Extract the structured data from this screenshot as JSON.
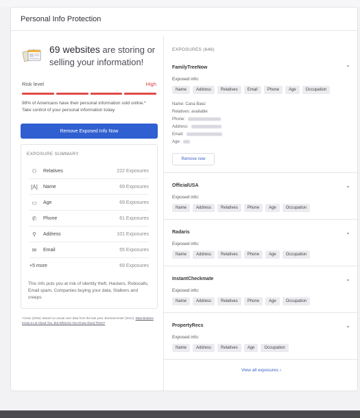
{
  "card": {
    "title": "Personal Info Protection"
  },
  "hero": {
    "count_text": "69 websites",
    "rest_text": " are storing or selling your information!",
    "icon": "browser-windows-icon"
  },
  "risk": {
    "label": "Risk level",
    "value": "High",
    "segments_filled": 4,
    "segments_total": 4,
    "note": "98% of Americans have their personal information sold online.* Take control of your personal information today."
  },
  "remove_button": {
    "label": "Remove Exposed Info Now"
  },
  "summary": {
    "title": "EXPOSURE SUMMARY",
    "rows": [
      {
        "icon": "people-icon",
        "glyph": "⚇",
        "label": "Relatives",
        "count": "222 Exposures"
      },
      {
        "icon": "name-icon",
        "glyph": "[A]",
        "label": "Name",
        "count": "69 Exposures"
      },
      {
        "icon": "calendar-icon",
        "glyph": "▭",
        "label": "Age",
        "count": "69 Exposures"
      },
      {
        "icon": "phone-icon",
        "glyph": "✆",
        "label": "Phone",
        "count": "61 Exposures"
      },
      {
        "icon": "address-icon",
        "glyph": "⚲",
        "label": "Address",
        "count": "101 Exposures"
      },
      {
        "icon": "email-icon",
        "glyph": "✉",
        "label": "Email",
        "count": "55 Exposures"
      },
      {
        "icon": "",
        "glyph": "",
        "label": "+5 more",
        "count": "69 Exposures"
      }
    ],
    "note": "This info puts you at risk of identity theft, Hackers, Robocalls, Email spam, Companies buying your data, Stalkers and creeps"
  },
  "footnote": {
    "text": "*Amaz (2025): Based on actual user data from the last year. Bremancenter (2014). ",
    "link": "Data Brokers Know a Lot About You. But What Do You Know About Them?"
  },
  "exposures": {
    "header": "EXPOSURES (646)",
    "exposed_label": "Exposed info:",
    "sites": [
      {
        "name": "FamilyTreeNow",
        "expanded": true,
        "tags": [
          "Name",
          "Address",
          "Relatives",
          "Email",
          "Phone",
          "Age",
          "Occupation"
        ],
        "details": {
          "name_line": "Name:  Cana Baez",
          "relatives_line": "Relatives:  available",
          "phone_label": "Phone:",
          "address_label": "Address:",
          "email_label": "Email:",
          "age_label": "Age:"
        },
        "remove_label": "Remove now"
      },
      {
        "name": "OfficialUSA",
        "expanded": false,
        "tags": [
          "Name",
          "Address",
          "Relatives",
          "Phone",
          "Age",
          "Occupation"
        ]
      },
      {
        "name": "Radaris",
        "expanded": false,
        "tags": [
          "Name",
          "Address",
          "Relatives",
          "Phone",
          "Age",
          "Occupation"
        ]
      },
      {
        "name": "InstantCheckmate",
        "expanded": false,
        "tags": [
          "Name",
          "Address",
          "Relatives",
          "Phone",
          "Age",
          "Occupation"
        ]
      },
      {
        "name": "PropertyRecs",
        "expanded": false,
        "tags": [
          "Name",
          "Address",
          "Relatives",
          "Age",
          "Occupation"
        ]
      }
    ],
    "view_all": "View all exposures  ›"
  },
  "colors": {
    "accent": "#2f5fd0",
    "risk": "#e04845",
    "link": "#3b5fc4"
  }
}
